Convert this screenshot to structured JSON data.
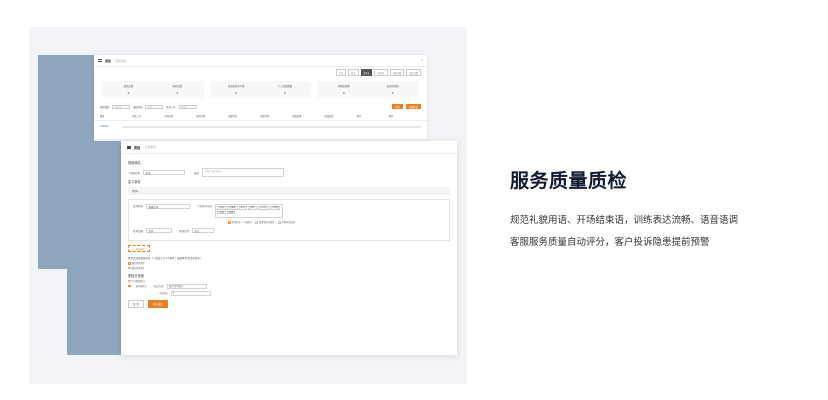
{
  "back_window": {
    "app_title": "质检",
    "breadcrumb": "/ 通话质检",
    "close_icon": "×",
    "filters": [
      "今天",
      "昨天",
      "近7天",
      "近30天",
      "开始日期",
      "结束日期"
    ],
    "stats": [
      [
        {
          "label": "通话总数",
          "value": "2"
        },
        {
          "label": "质检总数",
          "value": "2"
        }
      ],
      [
        {
          "label": "自动质检命中数",
          "value": "0"
        },
        {
          "label": "人工复核数量",
          "value": "0"
        }
      ],
      [
        {
          "label": "问题质检数",
          "value": "0"
        },
        {
          "label": "投诉风险数",
          "value": "0"
        }
      ]
    ],
    "search": {
      "label1": "质检规则",
      "ph1": "请选择",
      "label2": "通话状态",
      "ph2": "全部",
      "label3": "坐席工号",
      "ph3": "请输入",
      "btn_export": "导出",
      "btn_new": "新增质检"
    },
    "table_headers": [
      "通话",
      "坐席工号",
      "主叫号码",
      "被叫号码",
      "通话时长",
      "质检时间",
      "质检结果",
      "复核状态",
      "得分",
      "操作"
    ],
    "row_link": "100062"
  },
  "front_window": {
    "app_title": "质检",
    "breadcrumb": "/ 新建规则",
    "basic_title": "规则命名",
    "rule_name_label": "* 规则名称",
    "rule_name_value": "投诉",
    "rule_desc_label": "描述",
    "rule_desc_placeholder": "请输入规则描述",
    "cond_title": "定义条件",
    "cond_head": "条件1",
    "detect_label": "检测角色",
    "detect_value": "客服坐席",
    "keyword_label": "* 关键词/语句",
    "keywords": [
      "投诉",
      "不满意",
      "差评",
      "退款",
      "12315",
      "工信部",
      "主管",
      "经理"
    ],
    "radio_options": [
      "检测包含一个关键词",
      "检测全部关键词",
      "不检测关键词"
    ],
    "range_label": "检测范围",
    "range_value": "全部",
    "range2_label": "检测位置",
    "range2_value": "全文",
    "add_cond": "+ 添加条件",
    "logic_text": "条件之间的逻辑关系（一共定义了1个条件，选择条件之间的关系）",
    "logic_options": [
      "满足所有条件",
      "满足任意条件"
    ],
    "score_title": "质检分设置",
    "score_options": [
      "不计算质检分",
      "扣除质检分"
    ],
    "score_mode_label": "扣分方式",
    "score_mode_value": "每次命中扣分",
    "score_label": "* 扣分值",
    "score_value": "1",
    "btn_cancel": "取 消",
    "btn_save": "保存规则"
  },
  "marketing": {
    "title": "服务质量质检",
    "line1": "规范礼貌用语、开场结束语，训练表达流畅、语音语调",
    "line2": "客服服务质量自动评分，客户投诉隐患提前预警"
  }
}
